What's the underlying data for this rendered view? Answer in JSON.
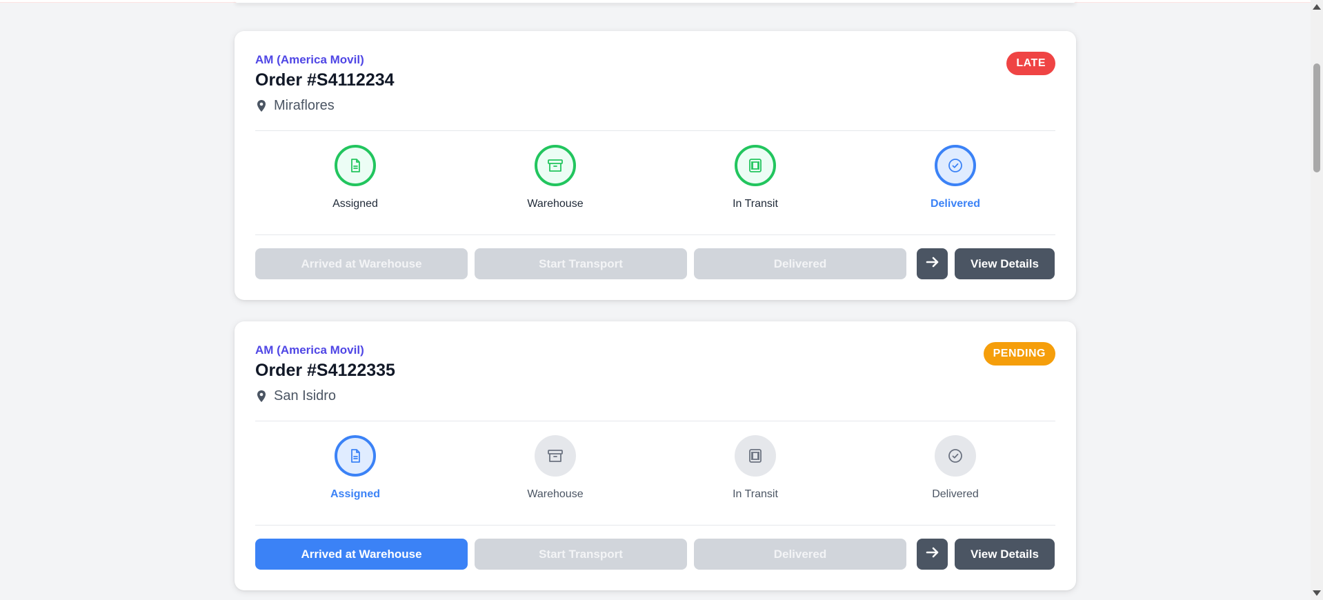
{
  "colors": {
    "brand": "#4f46e5",
    "done": "#22c55e",
    "active": "#3b82f6",
    "late": "#ef4444",
    "pending": "#f59e0b",
    "disabled": "#d1d5db",
    "dark": "#4b5563"
  },
  "orders": [
    {
      "company": "AM (America Movil)",
      "title": "Order #S4112234",
      "location": "Miraflores",
      "status": "LATE",
      "status_color": "#ef4444",
      "steps": [
        {
          "label": "Assigned",
          "state": "done",
          "icon": "document-icon"
        },
        {
          "label": "Warehouse",
          "state": "done",
          "icon": "archive-box-icon"
        },
        {
          "label": "In Transit",
          "state": "done",
          "icon": "truck-transit-icon"
        },
        {
          "label": "Delivered",
          "state": "active",
          "icon": "check-circle-icon"
        }
      ],
      "actions": {
        "arrived": {
          "label": "Arrived at Warehouse",
          "enabled": false
        },
        "start": {
          "label": "Start Transport",
          "enabled": false
        },
        "delivered": {
          "label": "Delivered",
          "enabled": false
        },
        "next_icon": "arrow-right-icon",
        "details": "View Details"
      }
    },
    {
      "company": "AM (America Movil)",
      "title": "Order #S4122335",
      "location": "San Isidro",
      "status": "PENDING",
      "status_color": "#f59e0b",
      "steps": [
        {
          "label": "Assigned",
          "state": "active",
          "icon": "document-icon"
        },
        {
          "label": "Warehouse",
          "state": "inactive",
          "icon": "archive-box-icon"
        },
        {
          "label": "In Transit",
          "state": "inactive",
          "icon": "truck-transit-icon"
        },
        {
          "label": "Delivered",
          "state": "inactive",
          "icon": "check-circle-icon"
        }
      ],
      "actions": {
        "arrived": {
          "label": "Arrived at Warehouse",
          "enabled": true
        },
        "start": {
          "label": "Start Transport",
          "enabled": false
        },
        "delivered": {
          "label": "Delivered",
          "enabled": false
        },
        "next_icon": "arrow-right-icon",
        "details": "View Details"
      }
    }
  ]
}
